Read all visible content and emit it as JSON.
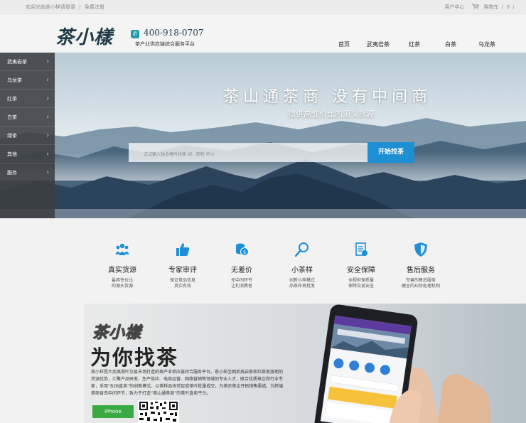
{
  "topbar": {
    "welcome": "欢迎光临茶小样请登录",
    "divider": "|",
    "register": "免费注册",
    "user_center": "用户中心",
    "cart_label": "购物车（",
    "cart_count": "0",
    "cart_close": "）"
  },
  "header": {
    "logo": "茶小樣",
    "phone": "400-918-0707",
    "slogan": "茶产业供应链综合服务平台",
    "nav": [
      "首页",
      "武夷岩茶",
      "红茶",
      "白茶",
      "乌龙茶"
    ]
  },
  "sidebar": {
    "items": [
      "武夷岩茶",
      "乌龙茶",
      "红茶",
      "白茶",
      "绿茶",
      "其他",
      "服务"
    ]
  },
  "hero": {
    "title": "茶山通茶商 没有中间商",
    "subtitle": "提供高性价比的源头货源",
    "search_placeholder": "试试输入独合春所找害 如：肉桂 中火",
    "search_button": "开始找茶"
  },
  "features": [
    {
      "icon": "people-icon",
      "title": "真实货源",
      "desc1": "最具性价比",
      "desc2": "的源头货源"
    },
    {
      "icon": "thumbs-up-icon",
      "title": "专家审评",
      "desc1": "保证茶品信息",
      "desc2": "真实有效"
    },
    {
      "icon": "coins-icon",
      "title": "无差价",
      "desc1": "无中间环节",
      "desc2": "让利消费者"
    },
    {
      "icon": "magnifier-icon",
      "title": "小茶样",
      "desc1": "创新小样模式",
      "desc2": "品茶样再批发"
    },
    {
      "icon": "document-icon",
      "title": "安全保障",
      "desc1": "全程担保质量",
      "desc2": "保障交易安全"
    },
    {
      "icon": "shield-icon",
      "title": "售后服务",
      "desc1": "完善的售后服务",
      "desc2": "健全的纠纷处理机制"
    }
  ],
  "promo": {
    "logo": "茶小樣",
    "title": "为你找茶",
    "description": "茶小样是大武夷茶叶交易市场打造的茶产业供应链综合服务平台。茶小样坐拥武夷岩茶和红茶发源地的资源优势，汇聚产品研发、生产供应、电商运营、网络营销等领域的专业人才，联合优质茶企和行业专家，采用“B2B直卖”的创新模式，以茶样品体验促成茶叶批量成交，为茶农茶企开拓销售渠道，为终端茶商省去中间环节，致力于打造“茶山通茶商”的茶叶直卖平台。",
    "iphone_button": "iPhone"
  },
  "colors": {
    "accent": "#1e8fd3",
    "logo": "#1e3a46",
    "green": "#3aa843",
    "sidebar": "#3c3e42"
  }
}
